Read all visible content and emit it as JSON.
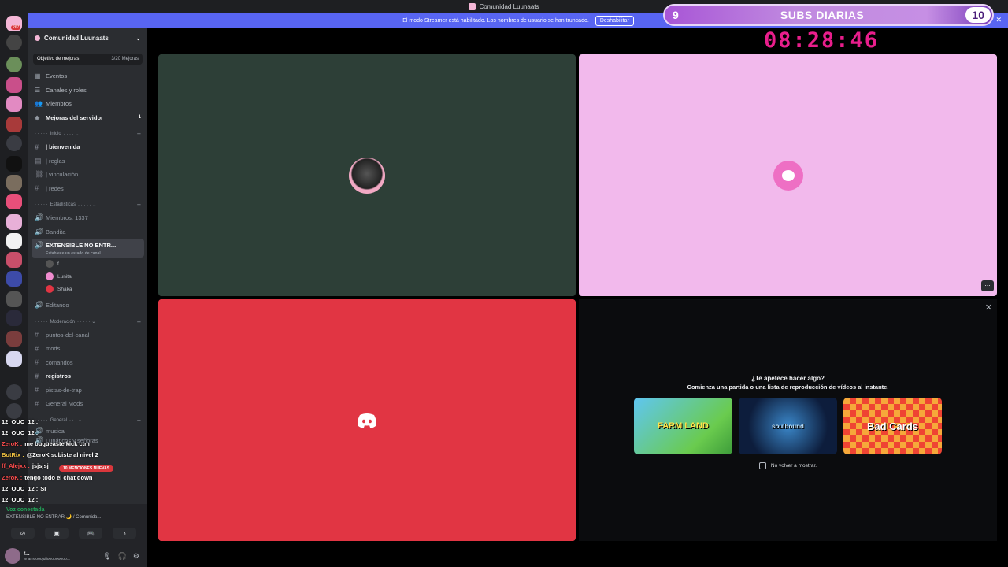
{
  "window": {
    "title": "Comunidad Luunaats"
  },
  "streamer_bar": {
    "message": "El modo Streamer está habilitado. Los nombres de usuario se han truncado.",
    "button": "Deshabilitar"
  },
  "subs_overlay": {
    "current": "9",
    "title": "SUBS DIARIAS",
    "goal": "10"
  },
  "timer": "08:28:46",
  "server": {
    "name": "Comunidad Luunaats",
    "boost_goal": "Objetivo de mejoras",
    "boost_progress": "3/20 Mejoras",
    "menu": [
      {
        "label": "Eventos",
        "icon": "calendar-icon"
      },
      {
        "label": "Canales y roles",
        "icon": "list-icon"
      },
      {
        "label": "Miembros",
        "icon": "members-icon"
      },
      {
        "label": "Mejoras del servidor",
        "icon": "boost-icon",
        "count": "1"
      }
    ]
  },
  "categories": {
    "inicio": "Inicio",
    "estadisticas": "Estadísticas",
    "moderacion": "Moderación",
    "general": "General"
  },
  "channels_inicio": [
    "| bienvenida",
    "| reglas",
    "| vinculación",
    "| redes"
  ],
  "channels_stats": [
    "Miembros: 1337",
    "Bandita",
    "EXTENSIBLE NO ENTR..."
  ],
  "active_channel_status": "Establece un estado de canal",
  "voice_members": [
    "f...",
    "Lunita",
    "Shaka"
  ],
  "channels_stats_2": [
    "Editando"
  ],
  "channels_moderacion": [
    "puntos-del-canal",
    "mods",
    "comandos",
    "registros",
    "pistas-de-trap",
    "General Mods"
  ],
  "channels_general": [
    "musica",
    "Lunáticos y señoras"
  ],
  "mentions_badge": "10 MENCIONES NUEVAS",
  "chat": [
    {
      "user": "12_OUC_12 :",
      "msg": "",
      "color": "#ffffff"
    },
    {
      "user": "12_OUC_12 :",
      "msg": "",
      "color": "#ffffff"
    },
    {
      "user": "ZeroK :",
      "msg": "me bugueaste kick ctm",
      "color": "#ff4d4d"
    },
    {
      "user": "BotRix :",
      "msg": "@ZeroK subiste al nivel 2",
      "color": "#f5c542"
    },
    {
      "user": "ff_Alejxx :",
      "msg": "jsjsjsj",
      "color": "#ff4d4d"
    },
    {
      "user": "ZeroK :",
      "msg": "tengo todo el chat down",
      "color": "#ff4d4d"
    },
    {
      "user": "12_OUC_12 :",
      "msg": "SI",
      "color": "#ffffff"
    },
    {
      "user": "12_OUC_12 :",
      "msg": "",
      "color": "#ffffff"
    }
  ],
  "voice_panel": {
    "status": "Voz conectada",
    "channel": "EXTENSIBLE NO ENTRAR 🌙 / Comunida..."
  },
  "user": {
    "name": "f...",
    "status": "te amoooojuliooooooooo..."
  },
  "activity": {
    "question": "¿Te apetece hacer algo?",
    "subtitle": "Comienza una partida o una lista de reproducción de vídeos al instante.",
    "games": [
      "FARM LAND",
      "soulbound",
      "Bad Cards"
    ],
    "dont_show": "No volver a mostrar."
  }
}
